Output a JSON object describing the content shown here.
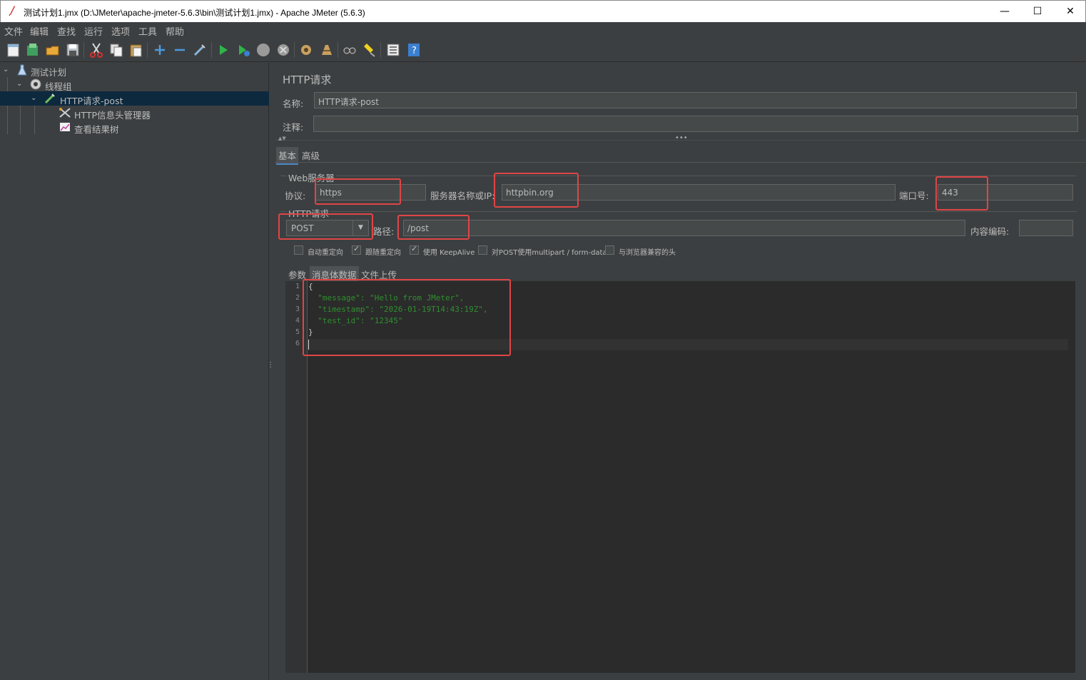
{
  "window": {
    "title": "测试计划1.jmx (D:\\JMeter\\apache-jmeter-5.6.3\\bin\\测试计划1.jmx) - Apache JMeter (5.6.3)",
    "minimize": "—",
    "maximize": "☐",
    "close": "✕"
  },
  "menu": [
    "文件",
    "编辑",
    "查找",
    "运行",
    "选项",
    "工具",
    "帮助"
  ],
  "tree": {
    "items": [
      {
        "label": "测试计划"
      },
      {
        "label": "线程组"
      },
      {
        "label": "HTTP请求-post"
      },
      {
        "label": "HTTP信息头管理器"
      },
      {
        "label": "查看结果树"
      }
    ]
  },
  "panel": {
    "title": "HTTP请求",
    "name_label": "名称:",
    "name_value": "HTTP请求-post",
    "comment_label": "注释:",
    "comment_value": "",
    "tabs": [
      "基本",
      "高级"
    ],
    "web_server_label": "Web服务器",
    "protocol_label": "协议:",
    "protocol_value": "https",
    "server_label": "服务器名称或IP:",
    "server_value": "httpbin.org",
    "port_label": "端口号:",
    "port_value": "443",
    "http_request_label": "HTTP请求",
    "method_value": "POST",
    "path_label": "路径:",
    "path_value": "/post",
    "encoding_label": "内容编码:",
    "encoding_value": "",
    "checkboxes": [
      {
        "label": "自动重定向",
        "checked": false
      },
      {
        "label": "跟随重定向",
        "checked": true
      },
      {
        "label": "使用 KeepAlive",
        "checked": true
      },
      {
        "label": "对POST使用multipart / form-data",
        "checked": false
      },
      {
        "label": "与浏览器兼容的头",
        "checked": false
      }
    ],
    "sub_tabs": [
      "参数",
      "消息体数据",
      "文件上传"
    ],
    "body_lines": [
      "{",
      "  \"message\": \"Hello from JMeter\",",
      "  \"timestamp\": \"2026-01-19T14:43:19Z\",",
      "  \"test_id\": \"12345\"",
      "}",
      ""
    ]
  },
  "colors": {
    "background": "#3c3f41",
    "editor": "#2b2b2b",
    "highlight": "#e04545",
    "selection": "#0d293e",
    "json_string": "#2f8f2f"
  }
}
